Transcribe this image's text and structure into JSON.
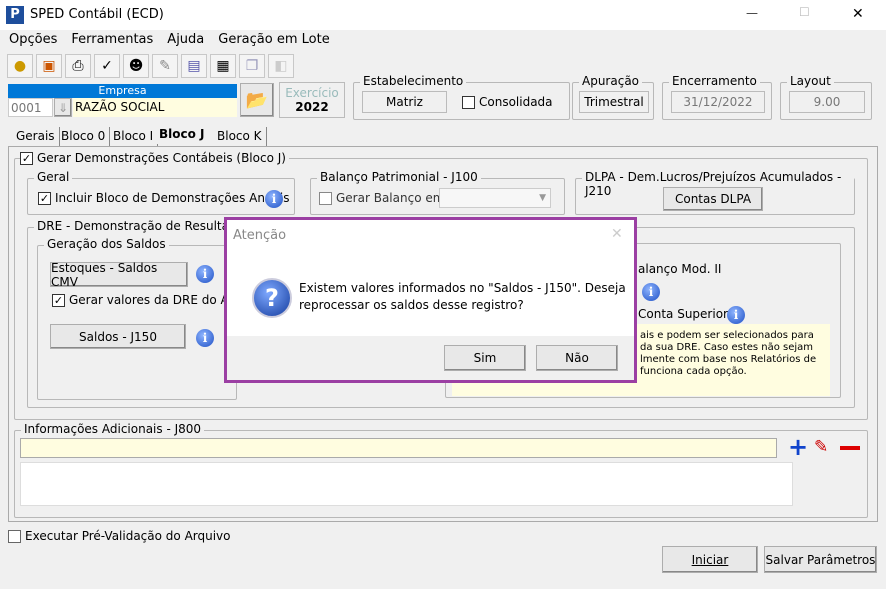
{
  "window": {
    "title": "SPED Contábil (ECD)",
    "min": "—",
    "max": "☐",
    "close": "✕"
  },
  "menu": [
    "Opções",
    "Ferramentas",
    "Ajuda",
    "Geração em Lote"
  ],
  "empresa": {
    "label": "Empresa",
    "code": "0001",
    "name": "RAZÃO SOCIAL"
  },
  "exercicio": {
    "label": "Exercício",
    "value": "2022"
  },
  "estabelecimento": {
    "label": "Estabelecimento",
    "value": "Matriz",
    "consolidada": "Consolidada"
  },
  "apuracao": {
    "label": "Apuração",
    "value": "Trimestral"
  },
  "encerramento": {
    "label": "Encerramento",
    "value": "31/12/2022"
  },
  "layout": {
    "label": "Layout",
    "value": "9.00"
  },
  "tabs": [
    "Gerais",
    "Bloco 0",
    "Bloco I",
    "Bloco J",
    "Bloco K"
  ],
  "blocoJ": {
    "gerar": "Gerar Demonstrações Contábeis (Bloco J)",
    "geral": {
      "label": "Geral",
      "incluir": "Incluir Bloco de Demonstrações Anuais"
    },
    "balanco": {
      "label": "Balanço Patrimonial - J100",
      "gerar": "Gerar Balanço em"
    },
    "dlpa": {
      "label": "DLPA - Dem.Lucros/Prejuízos Acumulados - J210",
      "button": "Contas DLPA"
    },
    "dre": {
      "label": "DRE - Demonstração de Resultado -",
      "saldos_label": "Geração dos Saldos",
      "estoques": "Estoques - Saldos CMV",
      "gerar_valores": "Gerar valores da DRE do Ano",
      "saldos": "Saldos - J150",
      "right_opt1": "alanço Mod. II",
      "right_opt2": "Conta Superior'",
      "note": [
        "ais e podem ser selecionados para",
        "da sua DRE. Caso estes não sejam",
        "lmente com base nos Relatórios de",
        "funciona cada opção."
      ]
    }
  },
  "info_adicionais": {
    "label": "Informações Adicionais - J800"
  },
  "executar": "Executar Pré-Validação do Arquivo",
  "buttons": {
    "iniciar": "Iniciar",
    "salvar": "Salvar Parâmetros"
  },
  "dialog": {
    "title": "Atenção",
    "message_line1": "Existem valores informados no \"Saldos - J150\". Deseja",
    "message_line2": "reprocessar os saldos desse registro?",
    "yes": "Sim",
    "no": "Não",
    "close": "✕"
  }
}
